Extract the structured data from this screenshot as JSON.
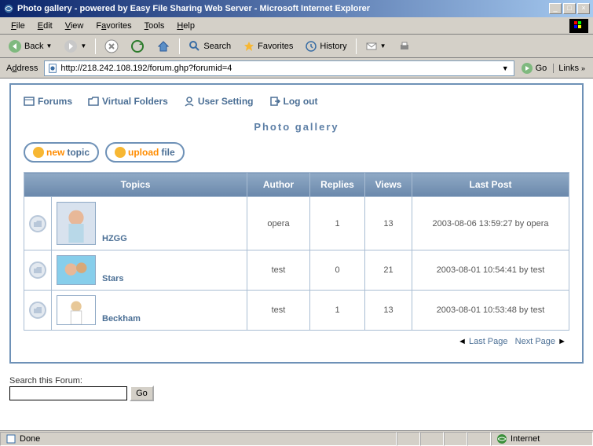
{
  "window": {
    "title": "Photo gallery - powered by Easy File Sharing Web Server - Microsoft Internet Explorer"
  },
  "menu": {
    "file": "File",
    "edit": "Edit",
    "view": "View",
    "favorites": "Favorites",
    "tools": "Tools",
    "help": "Help"
  },
  "toolbar": {
    "back": "Back",
    "search": "Search",
    "favorites": "Favorites",
    "history": "History"
  },
  "address": {
    "label": "Address",
    "url": "http://218.242.108.192/forum.ghp?forumid=4",
    "go": "Go",
    "links": "Links"
  },
  "nav": {
    "forums": "Forums",
    "vfolders": "Virtual Folders",
    "usersetting": "User Setting",
    "logout": "Log out"
  },
  "page": {
    "title": "Photo gallery"
  },
  "buttons": {
    "newtopic_a": "new",
    "newtopic_b": "topic",
    "upload_a": "upload",
    "upload_b": "file"
  },
  "table": {
    "headers": {
      "topics": "Topics",
      "author": "Author",
      "replies": "Replies",
      "views": "Views",
      "lastpost": "Last Post"
    },
    "rows": [
      {
        "name": "HZGG",
        "author": "opera",
        "replies": "1",
        "views": "13",
        "lastpost": "2003-08-06 13:59:27 by opera"
      },
      {
        "name": "Stars",
        "author": "test",
        "replies": "0",
        "views": "21",
        "lastpost": "2003-08-01 10:54:41 by test"
      },
      {
        "name": "Beckham",
        "author": "test",
        "replies": "1",
        "views": "13",
        "lastpost": "2003-08-01 10:53:48 by test"
      }
    ]
  },
  "pager": {
    "last": "Last Page",
    "next": "Next Page"
  },
  "search": {
    "label": "Search this Forum:",
    "go": "Go"
  },
  "status": {
    "done": "Done",
    "zone": "Internet"
  }
}
